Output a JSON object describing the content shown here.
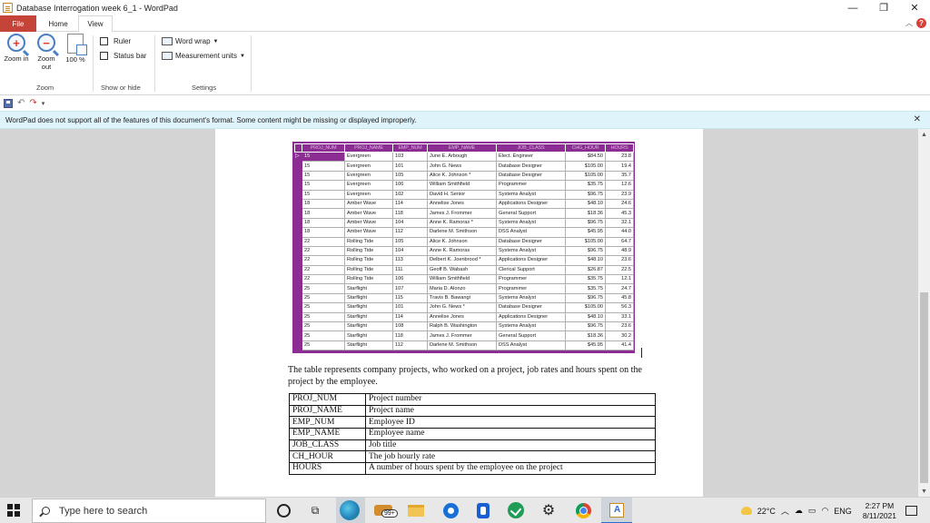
{
  "window": {
    "title": "Database Interrogation week 6_1 - WordPad",
    "controls": {
      "minimize": "—",
      "restore": "❐",
      "close": "✕"
    }
  },
  "ribbon": {
    "tabs": [
      {
        "label": "File"
      },
      {
        "label": "Home"
      },
      {
        "label": "View"
      }
    ],
    "zoom_group": {
      "label": "Zoom",
      "zoom_in": "Zoom in",
      "zoom_out": "Zoom out",
      "zoom_100": "100 %"
    },
    "show_hide_group": {
      "label": "Show or hide",
      "ruler": "Ruler",
      "status_bar": "Status bar"
    },
    "settings_group": {
      "label": "Settings",
      "word_wrap": "Word wrap",
      "measurement_units": "Measurement units"
    }
  },
  "warning": {
    "text": "WordPad does not support all of the features of this document's format. Some content might be missing or displayed improperly."
  },
  "db_table": {
    "headers": [
      "PROJ_NUM",
      "PROJ_NAME",
      "EMP_NUM",
      "EMP_NAME",
      "JOB_CLASS",
      "CHG_HOUR",
      "HOURS"
    ],
    "rows": [
      [
        "15",
        "Evergreen",
        "103",
        "June E. Arbough",
        "Elect. Engineer",
        "$84.50",
        "23.8"
      ],
      [
        "15",
        "Evergreen",
        "101",
        "John G. News",
        "Database Designer",
        "$105.00",
        "19.4"
      ],
      [
        "15",
        "Evergreen",
        "105",
        "Alice K. Johnson *",
        "Database Designer",
        "$105.00",
        "35.7"
      ],
      [
        "15",
        "Evergreen",
        "106",
        "William Smithfield",
        "Programmer",
        "$35.75",
        "12.6"
      ],
      [
        "15",
        "Evergreen",
        "102",
        "David H. Senior",
        "Systems Analyst",
        "$96.75",
        "23.9"
      ],
      [
        "18",
        "Amber Wave",
        "114",
        "Annelise Jones",
        "Applications Designer",
        "$48.10",
        "24.6"
      ],
      [
        "18",
        "Amber Wave",
        "118",
        "James J. Frommer",
        "General Support",
        "$18.36",
        "45.3"
      ],
      [
        "18",
        "Amber Wave",
        "104",
        "Anne K. Ramoras *",
        "Systems Analyst",
        "$96.75",
        "32.1"
      ],
      [
        "18",
        "Amber Wave",
        "112",
        "Darlene M. Smithson",
        "DSS Analyst",
        "$45.95",
        "44.0"
      ],
      [
        "22",
        "Rolling Tide",
        "105",
        "Alice K. Johnson",
        "Database Designer",
        "$105.00",
        "64.7"
      ],
      [
        "22",
        "Rolling Tide",
        "104",
        "Anne K. Ramoras",
        "Systems Analyst",
        "$96.75",
        "48.9"
      ],
      [
        "22",
        "Rolling Tide",
        "113",
        "Delbert K. Joenbrood *",
        "Applications Designer",
        "$48.10",
        "23.6"
      ],
      [
        "22",
        "Rolling Tide",
        "111",
        "Geoff B. Wabash",
        "Clerical Support",
        "$26.87",
        "22.5"
      ],
      [
        "22",
        "Rolling Tide",
        "106",
        "William Smithfield",
        "Programmer",
        "$35.75",
        "12.1"
      ],
      [
        "25",
        "Starflight",
        "107",
        "Maria D. Alonzo",
        "Programmer",
        "$35.75",
        "24.7"
      ],
      [
        "25",
        "Starflight",
        "115",
        "Travis B. Bawangi",
        "Systems Analyst",
        "$96.75",
        "45.8"
      ],
      [
        "25",
        "Starflight",
        "101",
        "John G. News *",
        "Database Designer",
        "$105.00",
        "56.3"
      ],
      [
        "25",
        "Starflight",
        "114",
        "Annelise Jones",
        "Applications Designer",
        "$48.10",
        "33.1"
      ],
      [
        "25",
        "Starflight",
        "108",
        "Ralph B. Washington",
        "Systems Analyst",
        "$96.75",
        "23.6"
      ],
      [
        "25",
        "Starflight",
        "118",
        "James J. Frommer",
        "General Support",
        "$18.36",
        "30.2"
      ],
      [
        "25",
        "Starflight",
        "112",
        "Darlene M. Smithson",
        "DSS Analyst",
        "$45.95",
        "41.4"
      ]
    ]
  },
  "document": {
    "paragraph": "The table represents company projects, who worked on a project, job rates and hours spent on the project by the employee.",
    "definitions": [
      [
        "PROJ_NUM",
        "Project number"
      ],
      [
        "PROJ_NAME",
        "Project name"
      ],
      [
        "EMP_NUM",
        "Employee ID"
      ],
      [
        "EMP_NAME",
        "Employee name"
      ],
      [
        "JOB_CLASS",
        "Job title"
      ],
      [
        "CH_HOUR",
        "The job hourly rate"
      ],
      [
        "HOURS",
        "A number of hours spent by the employee on the project"
      ]
    ]
  },
  "taskbar": {
    "search_placeholder": "Type here to search",
    "mail_badge": "99+",
    "weather": "22°C",
    "language": "ENG",
    "time": "2:27 PM",
    "date": "8/11/2021"
  },
  "colors": {
    "file_tab": "#c4443a",
    "db_accent": "#8b2d93",
    "warning_bg": "#dff3fb",
    "doc_bg": "#d4d4d4"
  }
}
